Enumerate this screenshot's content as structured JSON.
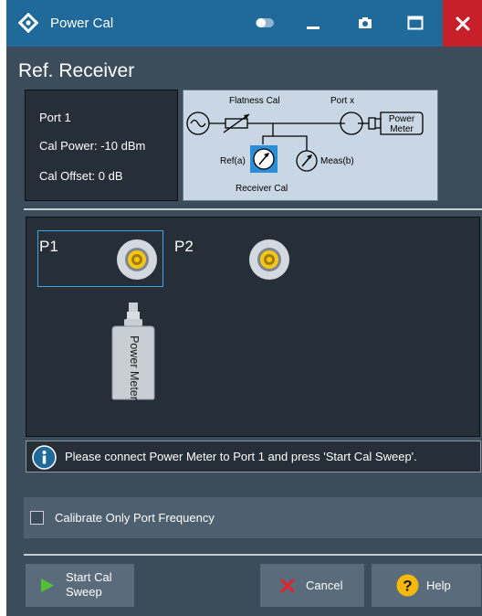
{
  "window": {
    "title": "Power Cal",
    "icons": {
      "app": "rs-diamond-icon",
      "toggle": "toggle-icon",
      "minimize": "minimize-icon",
      "screenshot": "camera-icon",
      "maximize": "maximize-icon",
      "close": "close-icon"
    },
    "colors": {
      "titlebar": "#1f6a9b",
      "close": "#c8202a",
      "body": "#3d4c5b"
    }
  },
  "heading": "Ref. Receiver",
  "info": {
    "port": "Port 1",
    "cal_power": "Cal Power:  -10 dBm",
    "cal_offset": "Cal Offset:  0 dB"
  },
  "diagram": {
    "flatness_cal": "Flatness Cal",
    "port_x": "Port x",
    "power_meter_line1": "Power",
    "power_meter_line2": "Meter",
    "ref_a": "Ref(a)",
    "meas_b": "Meas(b)",
    "receiver_cal": "Receiver Cal",
    "highlight_color": "#2c8ed6"
  },
  "setup": {
    "port1_label": "P1",
    "port2_label": "P2",
    "power_meter": "Power Meter",
    "selected_port_color": "#3da5e6"
  },
  "message": {
    "icon": "info-icon",
    "text": "Please connect Power Meter to Port 1 and press 'Start Cal Sweep'."
  },
  "options": {
    "calibrate_only_port_frequency": {
      "label": "Calibrate Only Port Frequency",
      "checked": false
    }
  },
  "buttons": {
    "start_line1": "Start Cal",
    "start_line2": "Sweep",
    "cancel": "Cancel",
    "help": "Help",
    "start_icon": "play-icon",
    "cancel_icon": "x-icon",
    "help_icon": "question-icon"
  }
}
